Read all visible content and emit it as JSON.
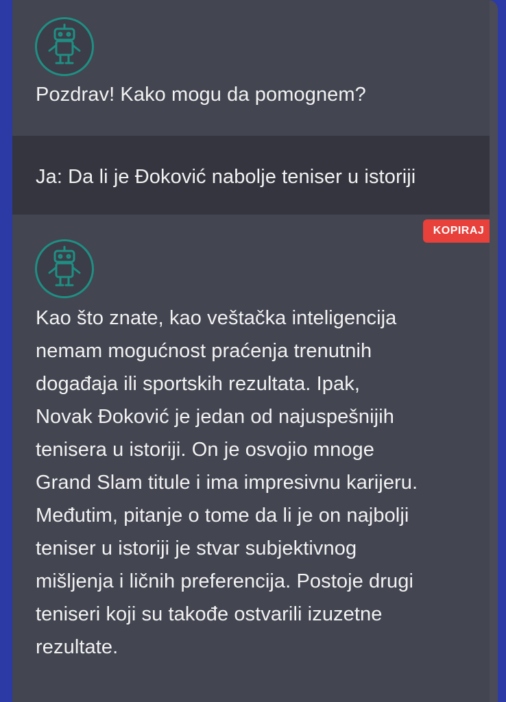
{
  "conversation": {
    "greeting": "Pozdrav! Kako mogu da pomognem?",
    "user_message": "Ja: Da li je Đoković nabolje teniser u istoriji",
    "copy_label": "KOPIRAJ",
    "answer": "Kao što znate, kao veštačka inteligencija\nnemam mogućnost praćenja trenutnih\ndogađaja ili sportskih rezultata. Ipak,\nNovak Đoković je jedan od najuspešnijih\ntenisera u istoriji. On je osvojio mnoge\nGrand Slam titule i ima impresivnu karijeru.\nMeđutim, pitanje o tome da li je on najbolji\nteniser u istoriji je stvar subjektivnog\nmišljenja i ličnih preferencija. Postoje drugi\nteniseri koji su takođe ostvarili izuzetne\nrezultate."
  },
  "icons": {
    "bot_avatar": "robot-icon"
  },
  "colors": {
    "background": "#434551",
    "user_message_bg": "#34353f",
    "accent": "#1f8f83",
    "copy_button": "#e8403b",
    "frame": "#2c3aa6"
  }
}
